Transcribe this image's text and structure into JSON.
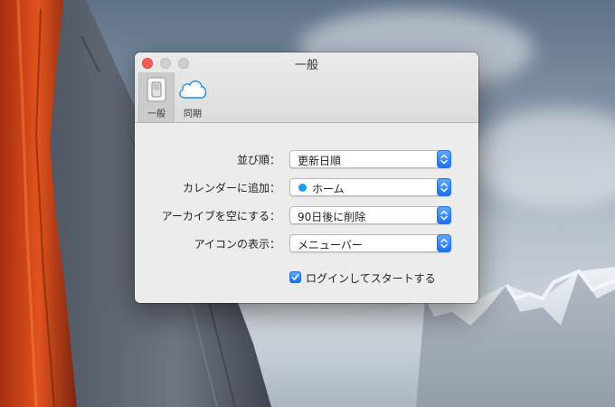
{
  "window": {
    "title": "一般"
  },
  "toolbar": {
    "tabs": [
      {
        "label": "一般",
        "icon": "switch-icon",
        "selected": true
      },
      {
        "label": "同期",
        "icon": "cloud-icon",
        "selected": false
      }
    ]
  },
  "settings": {
    "sort": {
      "label": "並び順：",
      "value": "更新日順"
    },
    "calendar": {
      "label": "カレンダーに追加：",
      "value": "ホーム",
      "dot_color": "#1a9bf0"
    },
    "archive": {
      "label": "アーカイブを空にする：",
      "value": "90日後に削除"
    },
    "icon_display": {
      "label": "アイコンの表示：",
      "value": "メニューバー"
    },
    "launch_at_login": {
      "label": "ログインしてスタートする",
      "checked": true
    }
  },
  "colors": {
    "accent": "#1d6ff2",
    "close": "#fc5d57"
  }
}
